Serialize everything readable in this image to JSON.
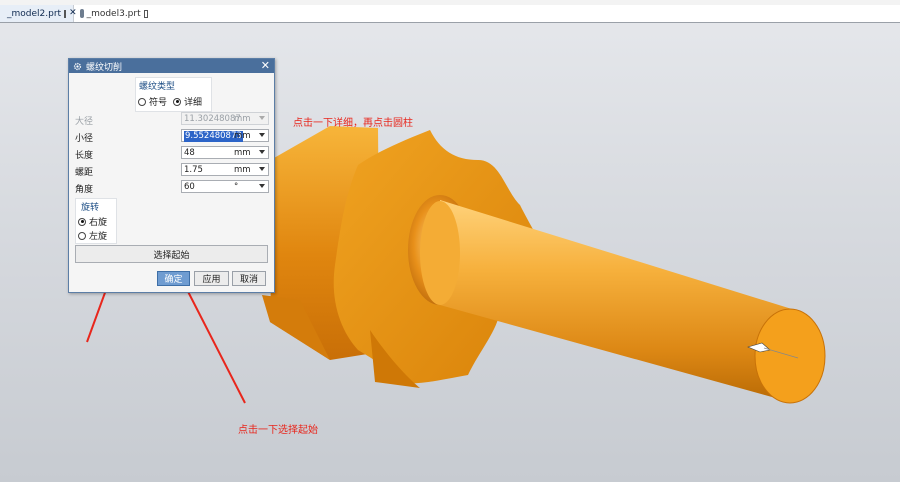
{
  "tabs": [
    {
      "label": "_model2.prt",
      "active": true
    },
    {
      "label": "_model3.prt",
      "active": false
    }
  ],
  "dialog": {
    "title": "螺纹切削",
    "thread_type": {
      "title": "螺纹类型",
      "options": [
        {
          "label": "符号",
          "selected": false
        },
        {
          "label": "详细",
          "selected": true
        }
      ]
    },
    "params": [
      {
        "label": "大径",
        "value": "11.30248087",
        "unit": "mm",
        "enabled": false
      },
      {
        "label": "小径",
        "value": "9.552480873",
        "unit": "mm",
        "enabled": true,
        "highlighted": true
      },
      {
        "label": "长度",
        "value": "48",
        "unit": "mm",
        "enabled": true
      },
      {
        "label": "螺距",
        "value": "1.75",
        "unit": "mm",
        "enabled": true
      },
      {
        "label": "角度",
        "value": "60",
        "unit": "°",
        "enabled": true
      }
    ],
    "rotation": {
      "title": "旋转",
      "options": [
        {
          "label": "右旋",
          "selected": true
        },
        {
          "label": "左旋",
          "selected": false
        }
      ]
    },
    "select_start_label": "选择起始",
    "buttons": {
      "ok": "确定",
      "apply": "应用",
      "cancel": "取消"
    }
  },
  "annotations": {
    "top": "点击一下详细，再点击圆柱",
    "bottom": "点击一下选择起始"
  },
  "colors": {
    "titlebar": "#4a6f9c",
    "annotation": "#e8261c",
    "part_orange": "#f1a21c"
  }
}
